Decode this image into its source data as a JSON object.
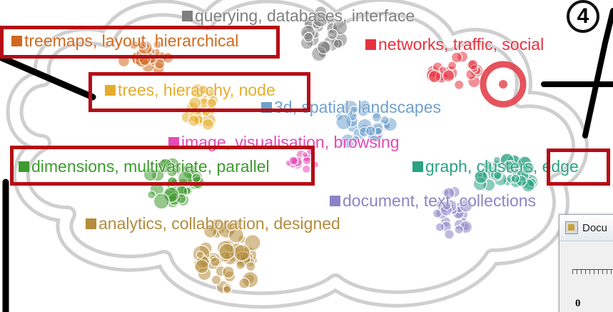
{
  "annotation_number": "4",
  "topics": [
    {
      "id": "querying",
      "label": "querying, databases, interface",
      "color": "#7f7f7f"
    },
    {
      "id": "treemaps",
      "label": "treemaps, layout, hierarchical",
      "color": "#d2691e"
    },
    {
      "id": "networks",
      "label": "networks, traffic, social",
      "color": "#e7313f"
    },
    {
      "id": "trees",
      "label": "trees, hierarchy, node",
      "color": "#e5ad2b"
    },
    {
      "id": "3d",
      "label": "3d, spatial, landscapes",
      "color": "#6fa0cd"
    },
    {
      "id": "image",
      "label": "image, visualisation, browsing",
      "color": "#e64ab6"
    },
    {
      "id": "dimensions",
      "label": "dimensions, multivariate, parallel",
      "color": "#3f9b2f"
    },
    {
      "id": "graph",
      "label": "graph, clusters, edge",
      "color": "#2aa383"
    },
    {
      "id": "document",
      "label": "document, text, collections",
      "color": "#8b84c6"
    },
    {
      "id": "analytics",
      "label": "analytics, collaboration, designed",
      "color": "#b48c3c"
    }
  ],
  "highlight_color": "#b50d16",
  "window": {
    "title": "Docu",
    "slider_value": "0"
  }
}
